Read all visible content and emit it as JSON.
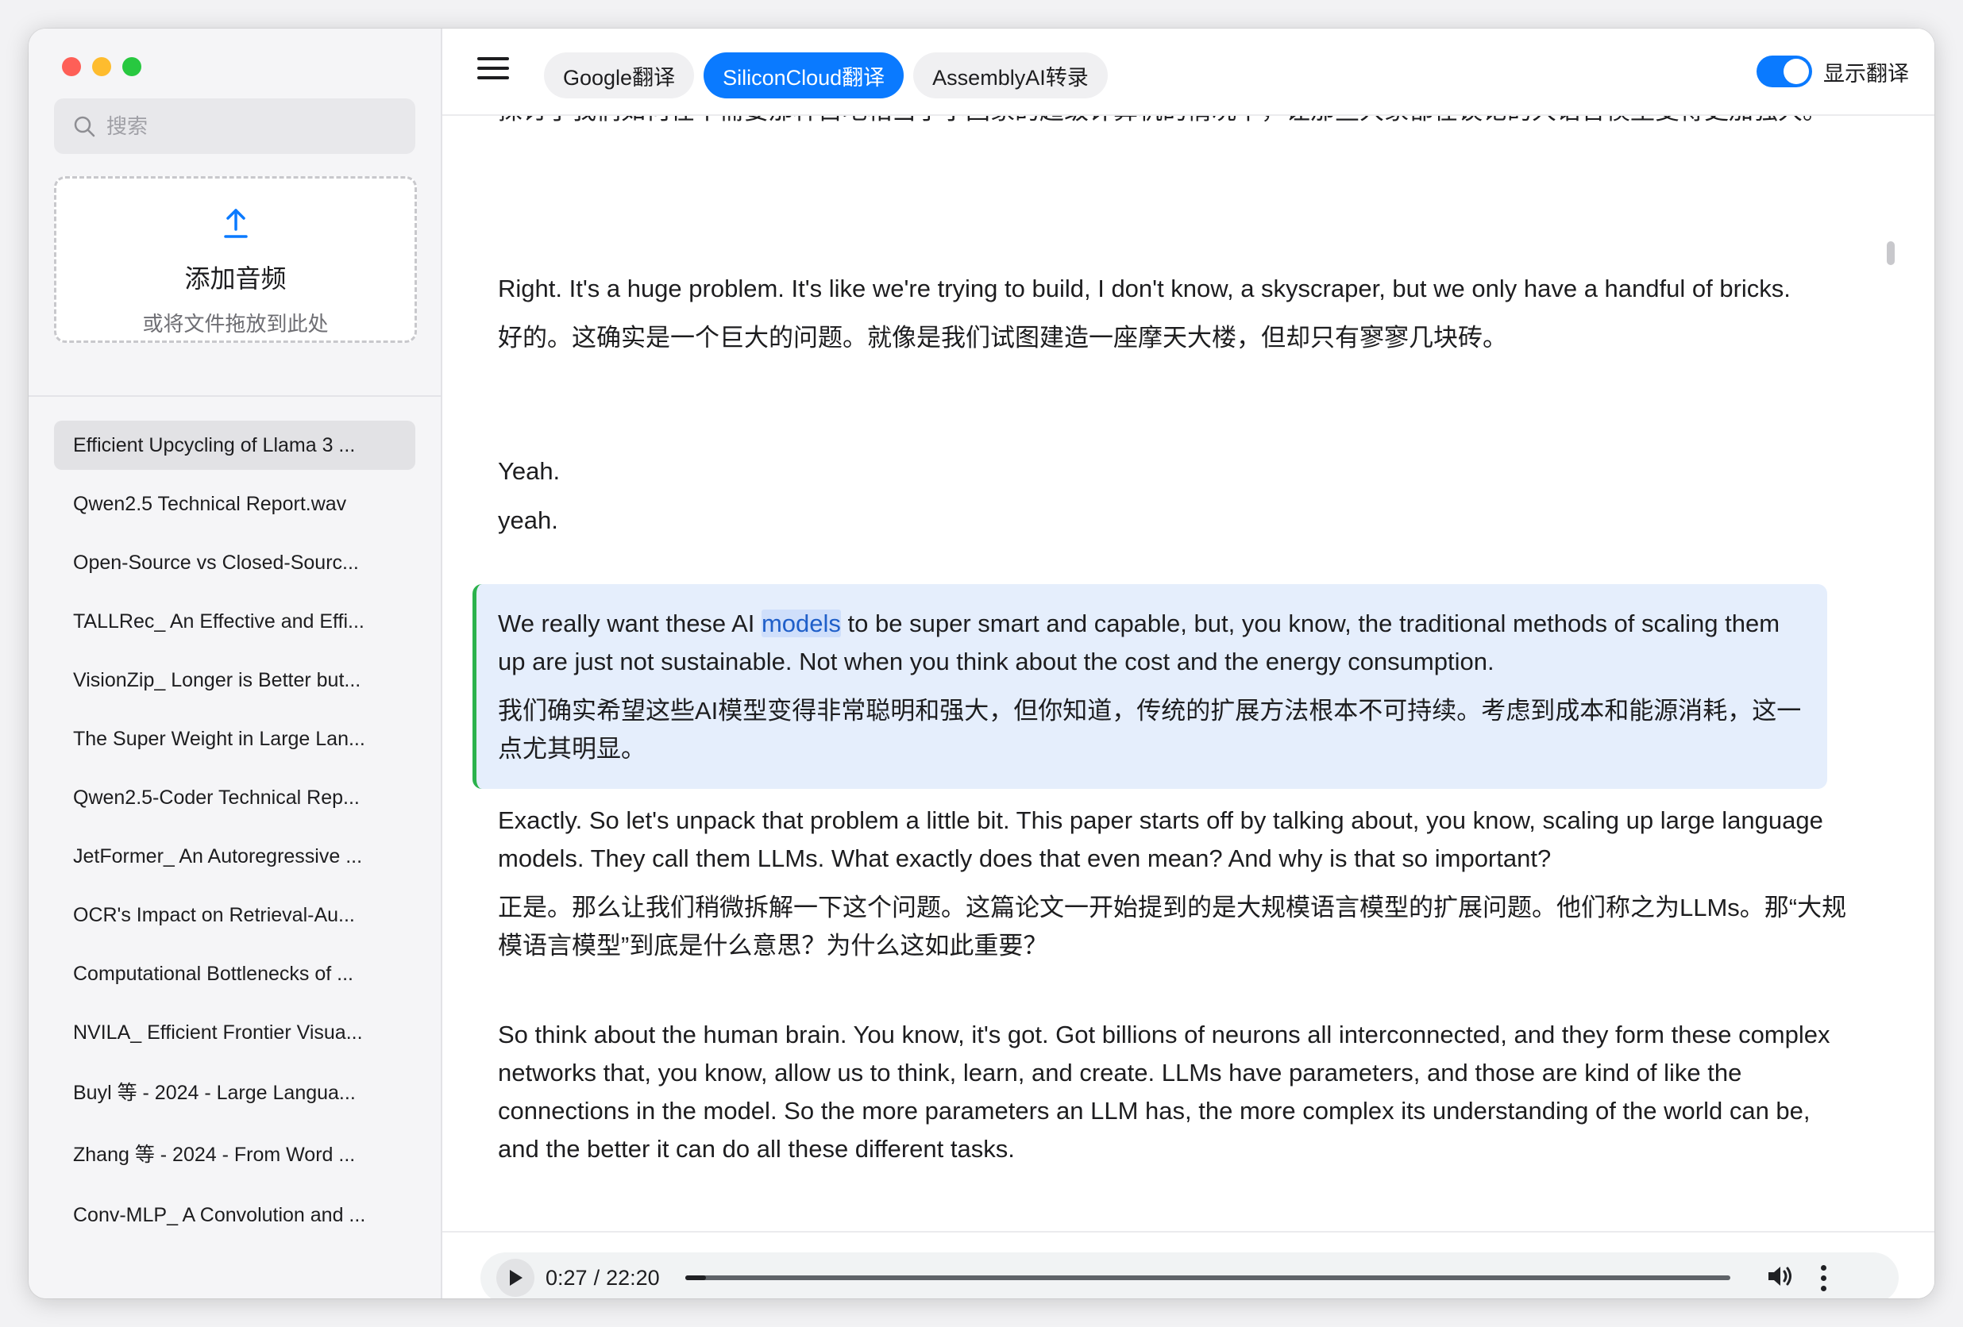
{
  "sidebar": {
    "search_placeholder": "搜索",
    "upload": {
      "title": "添加音频",
      "subtitle": "或将文件拖放到此处"
    },
    "files": [
      "Efficient Upcycling of Llama 3 ...",
      "Qwen2.5 Technical Report.wav",
      "Open-Source vs Closed-Sourc...",
      "TALLRec_ An Effective and Effi...",
      "VisionZip_ Longer is Better but...",
      "The Super Weight in Large Lan...",
      "Qwen2.5-Coder Technical Rep...",
      "JetFormer_ An Autoregressive ...",
      "OCR's Impact on Retrieval-Au...",
      "Computational Bottlenecks of ...",
      "NVILA_ Efficient Frontier Visua...",
      "Buyl 等 - 2024 - Large Langua...",
      "Zhang 等 - 2024 - From Word ...",
      "Conv-MLP_ A Convolution and ..."
    ],
    "active_index": 0
  },
  "toolbar": {
    "tabs": [
      "Google翻译",
      "SiliconCloud翻译",
      "AssemblyAI转录"
    ],
    "active_tab": 1,
    "toggle_label": "显示翻译",
    "toggle_on": true
  },
  "transcript": {
    "p0_zh": "探讨了我们如何在不需要那种占地相当于小国家的超级计算机的情况下，让那些大家都在谈论的大语言模型变得更加强大。",
    "p1_en": "Right. It's a huge problem. It's like we're trying to build, I don't know, a skyscraper, but we only have a handful of bricks.",
    "p1_zh": "好的。这确实是一个巨大的问题。就像是我们试图建造一座摩天大楼，但却只有寥寥几块砖。",
    "p2_en": "Yeah.",
    "p2_zh": "yeah.",
    "p3_en_before": "We really want these AI ",
    "p3_en_highlight": "models",
    "p3_en_after": " to be super smart and capable, but, you know, the traditional methods of scaling them up are just not sustainable. Not when you think about the cost and the energy consumption.",
    "p3_zh": "我们确实希望这些AI模型变得非常聪明和强大，但你知道，传统的扩展方法根本不可持续。考虑到成本和能源消耗，这一点尤其明显。",
    "p4_en": "Exactly. So let's unpack that problem a little bit. This paper starts off by talking about, you know, scaling up large language models. They call them LLMs. What exactly does that even mean? And why is that so important?",
    "p4_zh": "正是。那么让我们稍微拆解一下这个问题。这篇论文一开始提到的是大规模语言模型的扩展问题。他们称之为LLMs。那“大规模语言模型”到底是什么意思？为什么这如此重要？",
    "p5_en": "So think about the human brain. You know, it's got. Got billions of neurons all interconnected, and they form these complex networks that, you know, allow us to think, learn, and create. LLMs have parameters, and those are kind of like the connections in the model. So the more parameters an LLM has, the more complex its understanding of the world can be, and the better it can do all these different tasks."
  },
  "player": {
    "current": "0:27",
    "separator": "/",
    "duration": "22:20",
    "progress": 0.0203
  },
  "colors": {
    "accent": "#0a7aff",
    "active_border": "#2bb24c",
    "active_bg": "#e5eefc"
  }
}
